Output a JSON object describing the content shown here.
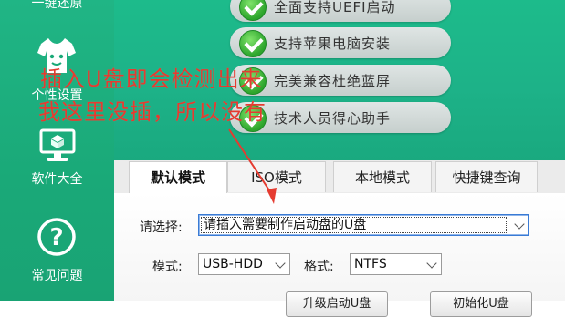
{
  "sidebar": {
    "items": [
      {
        "label": "一键还原",
        "icon": "restore-icon"
      },
      {
        "label": "个性设置",
        "icon": "tshirt-icon"
      },
      {
        "label": "软件大全",
        "icon": "monitor-icon"
      },
      {
        "label": "常见问题",
        "icon": "help-icon"
      }
    ]
  },
  "features": [
    {
      "text": "全面支持UEFI启动"
    },
    {
      "text": "支持苹果电脑安装"
    },
    {
      "text": "完美兼容杜绝蓝屏"
    },
    {
      "text": "技术人员得心助手"
    }
  ],
  "annotation": {
    "line1": "插入U盘即会检测出来",
    "line2": "我这里没插，所以没有",
    "color": "#e53b30"
  },
  "tabs": [
    {
      "label": "默认模式",
      "active": true
    },
    {
      "label": "ISO模式",
      "active": false
    },
    {
      "label": "本地模式",
      "active": false
    },
    {
      "label": "快捷键查询",
      "active": false
    }
  ],
  "form": {
    "select_label": "请选择:",
    "select_value": "请插入需要制作启动盘的U盘",
    "mode_label": "模式:",
    "mode_value": "USB-HDD",
    "format_label": "格式:",
    "format_value": "NTFS"
  },
  "buttons": {
    "left": "升级启动U盘",
    "right": "初始化U盘"
  },
  "colors": {
    "sidebar": "#1aa978",
    "banner": "#1db288",
    "annotation": "#e53b30"
  }
}
